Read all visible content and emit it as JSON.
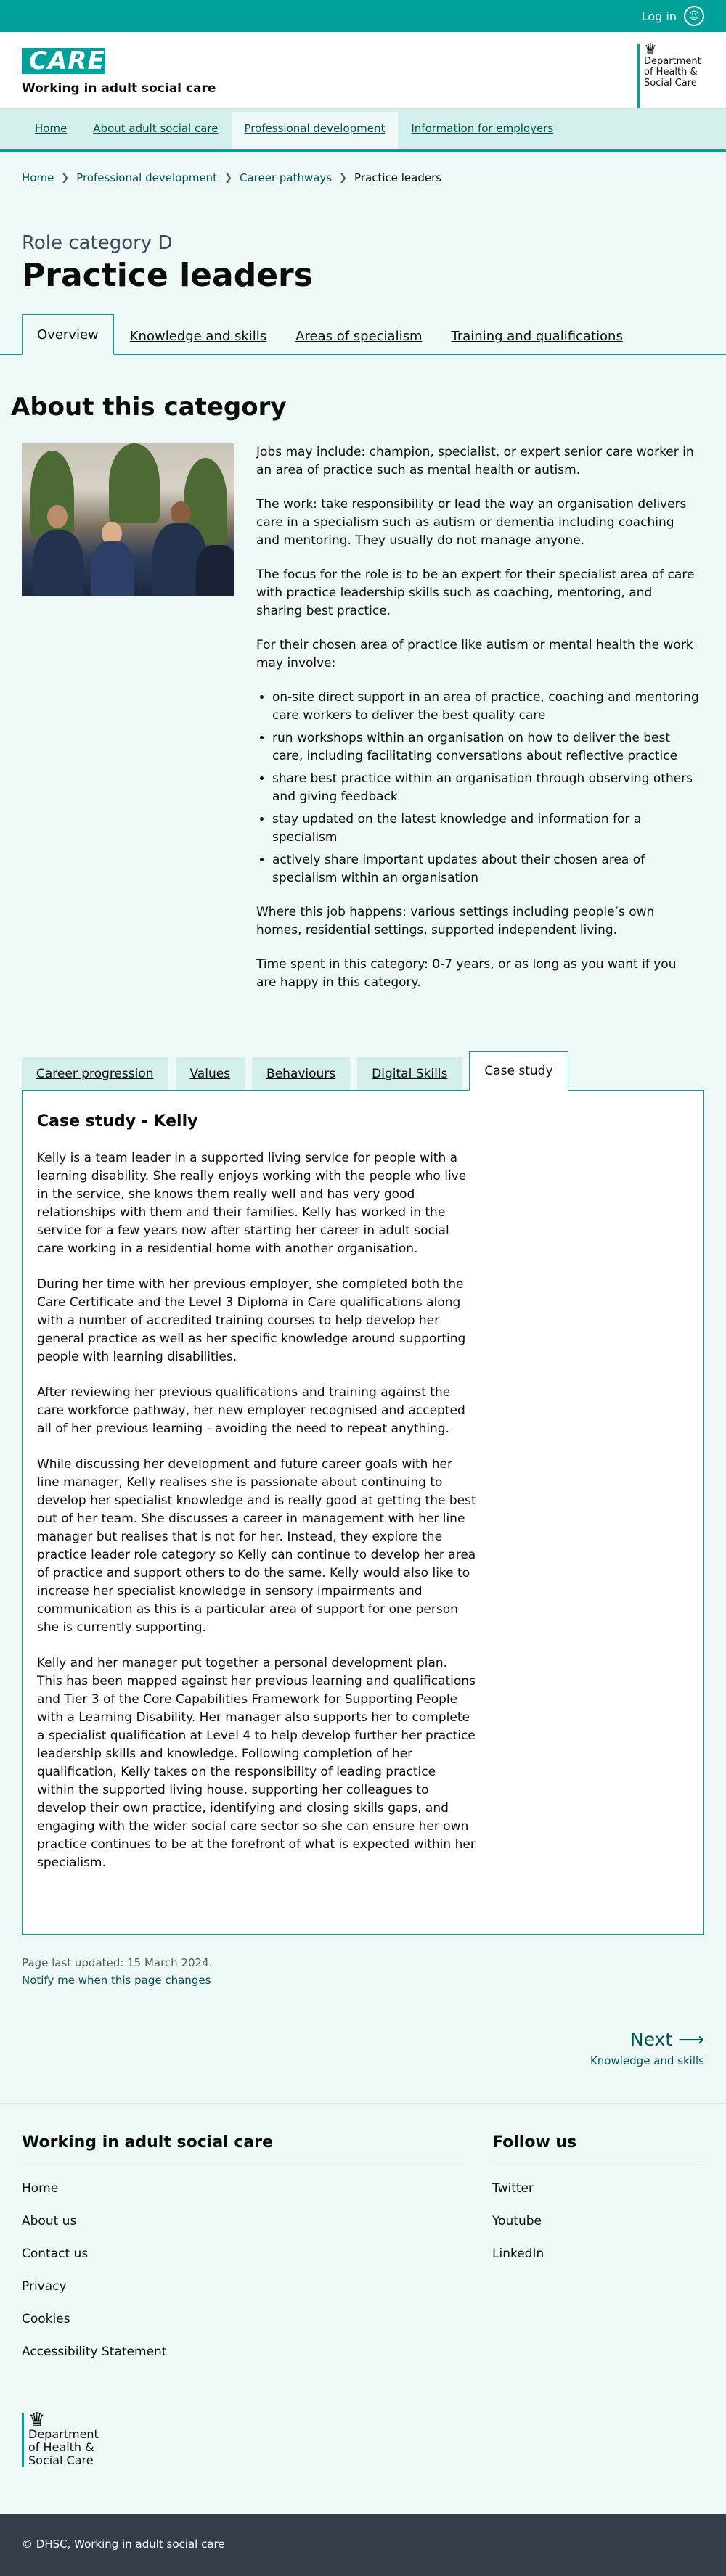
{
  "topbar": {
    "login_label": "Log in",
    "icon": "user-icon"
  },
  "header": {
    "logo_text": "CARE",
    "logo_subtitle": "Working in adult social care",
    "dhsc_lines": [
      "Department",
      "of Health &",
      "Social Care"
    ]
  },
  "nav": {
    "items": [
      {
        "label": "Home"
      },
      {
        "label": "About adult social care"
      },
      {
        "label": "Professional development"
      },
      {
        "label": "Information for employers"
      }
    ],
    "active_index": 2
  },
  "breadcrumb": [
    "Home",
    "Professional development",
    "Career pathways",
    "Practice leaders"
  ],
  "page": {
    "role_category": "Role category D",
    "title": "Practice leaders"
  },
  "tabs": [
    "Overview",
    "Knowledge and skills",
    "Areas of specialism",
    "Training and qualifications"
  ],
  "about": {
    "heading": "About this category",
    "paragraphs": [
      "Jobs may include: champion, specialist, or expert senior care worker in an area of practice such as mental health or autism.",
      "The work: take responsibility or lead the way an organisation delivers care in a specialism such as autism or dementia including coaching and mentoring. They usually do not manage anyone.",
      "The focus for the role is to be an expert for their specialist area of care with practice leadership skills such as coaching, mentoring, and sharing best practice.",
      "For their chosen area of practice like autism or mental health the work may involve:"
    ],
    "bullets": [
      "on-site direct support in an area of practice, coaching and mentoring care workers to deliver the best quality care",
      "run workshops within an organisation on how to deliver the best care, including facilitating conversations about reflective practice",
      "share best practice within an organisation through observing others and giving feedback",
      "stay updated on the latest knowledge and information for a specialism",
      "actively share important updates about their chosen area of specialism within an organisation"
    ],
    "after": [
      "Where this job happens: various settings including people’s own homes, residential settings, supported independent living.",
      "Time spent in this category: 0-7 years, or as long as you want if you are happy in this category."
    ]
  },
  "subtabs": [
    "Career progression",
    "Values",
    "Behaviours",
    "Digital Skills",
    "Case study"
  ],
  "case_study": {
    "title": "Case study - Kelly",
    "paragraphs": [
      "Kelly is a team leader in a supported living service for people with a learning disability. She really enjoys working with the people who live in the service, she knows them really well and has very good relationships with them and their families. Kelly has worked in the service for a few years now after starting her career in adult social care working in a residential home with another organisation.",
      "During her time with her previous employer, she completed both the Care Certificate and the Level 3 Diploma in Care qualifications along with a number of accredited training courses to help develop her general practice as well as her specific knowledge around supporting people with learning disabilities.",
      "After reviewing her previous qualifications and training against the care workforce pathway, her new employer recognised and accepted all of her previous learning - avoiding the need to repeat anything.",
      "While discussing her development and future career goals with her line manager, Kelly realises she is passionate about continuing to develop her specialist knowledge and is really good at getting the best out of her team. She discusses a career in management with her line manager but realises that is not for her. Instead, they explore the practice leader role category so Kelly can continue to develop her area of practice and support others to do the same. Kelly would also like to increase her specialist knowledge in sensory impairments and communication as this is a particular area of support for one person she is currently supporting.",
      "Kelly and her manager put together a personal development plan. This has been mapped against her previous learning and qualifications and Tier 3 of the Core Capabilities Framework for Supporting People with a Learning Disability. Her manager also supports her to complete a specialist qualification at Level 4 to help develop further her practice leadership skills and knowledge. Following completion of her qualification, Kelly takes on the responsibility of leading practice within the supported living house, supporting her colleagues to develop their own practice, identifying and closing skills gaps, and engaging with the wider social care sector so she can ensure her own practice continues to be at the forefront of what is expected within her specialism."
    ]
  },
  "meta": {
    "last_updated": "Page last updated: 15 March 2024.",
    "notify": "Notify me when this page changes"
  },
  "next": {
    "label": "Next",
    "target": "Knowledge and skills"
  },
  "footer": {
    "left_heading": "Working in adult social care",
    "left_links": [
      "Home",
      "About us",
      "Contact us",
      "Privacy",
      "Cookies",
      "Accessibility Statement"
    ],
    "right_heading": "Follow us",
    "right_links": [
      "Twitter",
      "Youtube",
      "LinkedIn"
    ],
    "dhsc_lines": [
      "Department",
      "of Health &",
      "Social Care"
    ],
    "copyright": "© DHSC, Working in adult social care"
  },
  "colors": {
    "brand": "#00a19a",
    "link": "#00524d",
    "footer_bar": "#343e4b"
  }
}
